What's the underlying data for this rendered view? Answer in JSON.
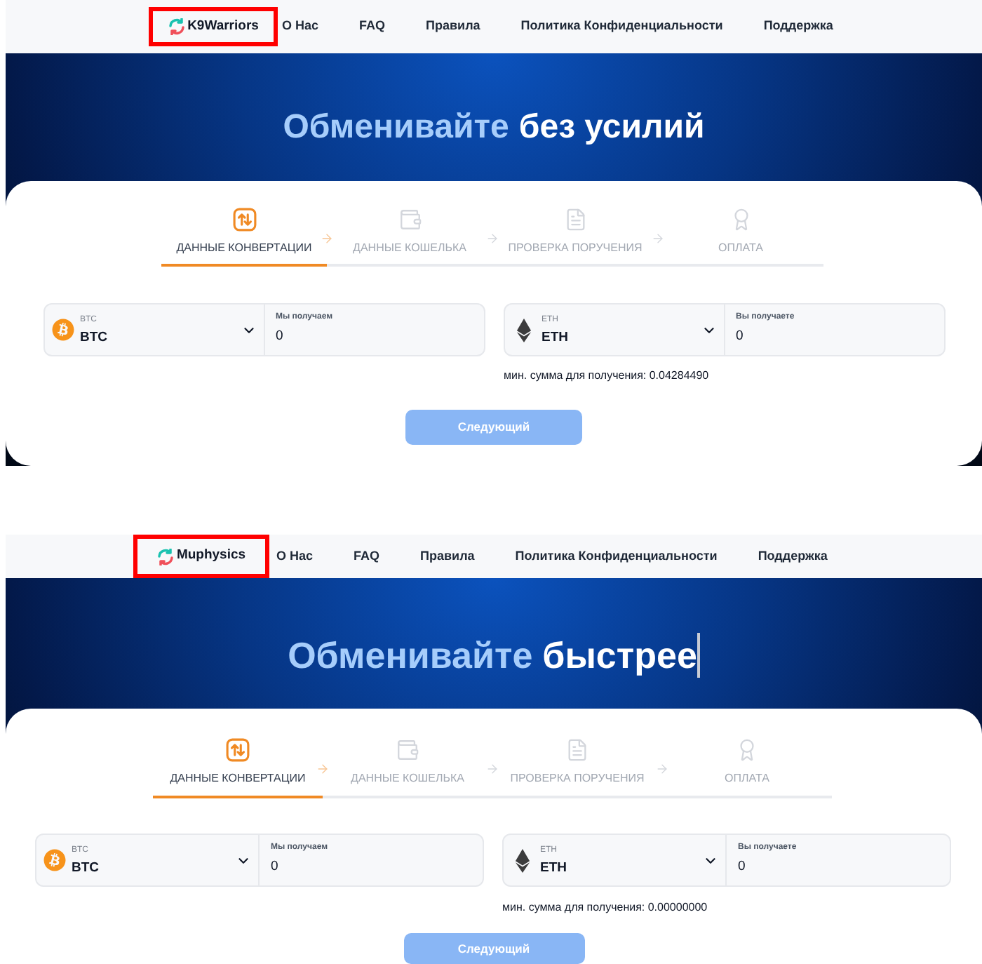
{
  "panels": [
    {
      "nav": {
        "logo": {
          "text": "K9Warriors",
          "highlighted": true
        },
        "links": [
          "О Нас",
          "FAQ",
          "Правила",
          "Политика Конфиденциальности",
          "Поддержка"
        ]
      },
      "hero": {
        "title_accent": "Обменивайте",
        "title_rest": "без усилий",
        "typing_cursor": false
      },
      "steps": [
        {
          "label": "ДАННЫЕ КОНВЕРТАЦИИ",
          "selected": true
        },
        {
          "label": "ДАННЫЕ КОШЕЛЬКА",
          "selected": false
        },
        {
          "label": "ПРОВЕРКА ПОРУЧЕНИЯ",
          "selected": false
        },
        {
          "label": "ОПЛАТА",
          "selected": false
        }
      ],
      "exchange": [
        {
          "kind": "bitcoin",
          "currency_label": "BTC",
          "currency": "BTC",
          "amount_label": "Мы получаем",
          "amount": "0"
        },
        {
          "kind": "ethereum",
          "currency_label": "ETH",
          "currency": "ETH",
          "amount_label": "Вы получаете",
          "amount": "0"
        }
      ],
      "min_amount": "мин. сумма для получения: 0.04284490",
      "next_button": {
        "label": "Следующий",
        "disabled": true
      }
    },
    {
      "nav": {
        "logo": {
          "text": "Muphysics",
          "highlighted": true
        },
        "links": [
          "О Нас",
          "FAQ",
          "Правила",
          "Политика Конфиденциальности",
          "Поддержка"
        ]
      },
      "hero": {
        "title_accent": "Обменивайте",
        "title_rest": "быстрее",
        "typing_cursor": true
      },
      "steps": [
        {
          "label": "ДАННЫЕ КОНВЕРТАЦИИ",
          "selected": true
        },
        {
          "label": "ДАННЫЕ КОШЕЛЬКА",
          "selected": false
        },
        {
          "label": "ПРОВЕРКА ПОРУЧЕНИЯ",
          "selected": false
        },
        {
          "label": "ОПЛАТА",
          "selected": false
        }
      ],
      "exchange": [
        {
          "kind": "bitcoin",
          "currency_label": "BTC",
          "currency": "BTC",
          "amount_label": "Мы получаем",
          "amount": "0"
        },
        {
          "kind": "ethereum",
          "currency_label": "ETH",
          "currency": "ETH",
          "amount_label": "Вы получаете",
          "amount": "0"
        }
      ],
      "min_amount": "мин. сумма для получения: 0.00000000",
      "next_button": {
        "label": "Следующий",
        "disabled": true
      }
    }
  ]
}
